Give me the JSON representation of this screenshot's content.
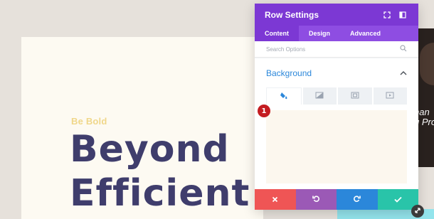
{
  "page": {
    "eyebrow": "Be Bold",
    "heading_line1": "Beyond",
    "heading_line2": "Efficient",
    "photo_text_line1": "han",
    "photo_text_line2": "g Pro"
  },
  "modal": {
    "title": "Row Settings",
    "tabs": [
      {
        "label": "Content",
        "active": true
      },
      {
        "label": "Design",
        "active": false
      },
      {
        "label": "Advanced",
        "active": false
      }
    ],
    "search_placeholder": "Search Options",
    "section_title": "Background",
    "background_tabs": [
      {
        "icon": "paint-bucket-icon",
        "active": true
      },
      {
        "icon": "gradient-icon",
        "active": false
      },
      {
        "icon": "image-icon",
        "active": false
      },
      {
        "icon": "video-icon",
        "active": false
      }
    ],
    "callout_number": "1"
  },
  "colors": {
    "header_purple": "#7c38d4",
    "tabs_purple": "#8e4de2",
    "accent_blue": "#2b87da",
    "cancel_red": "#ef5555",
    "undo_purple": "#9b59b6",
    "save_teal": "#29c4a9",
    "heading_navy": "#3f3d6c",
    "eyebrow_gold": "#f0d78a"
  }
}
